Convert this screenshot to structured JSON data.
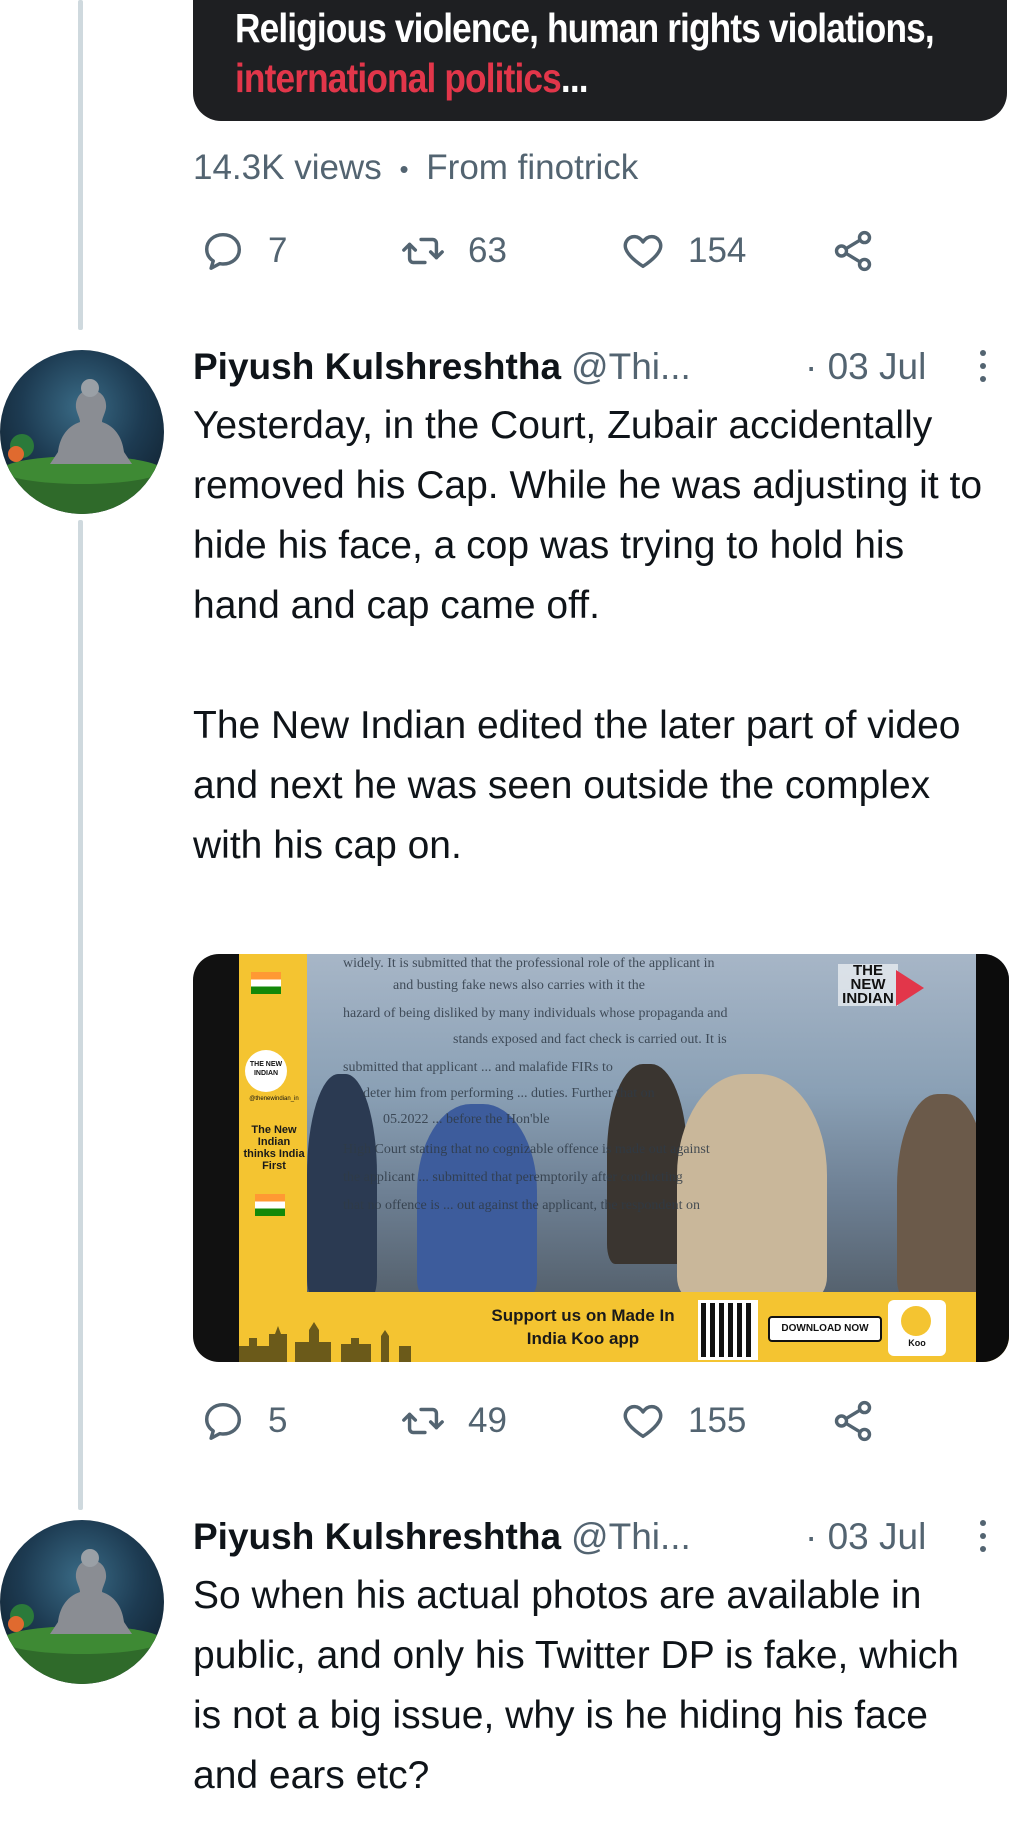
{
  "top_card": {
    "line1": "Religious violence, human rights violations,",
    "line2": "international politics",
    "ellipsis": "..."
  },
  "top_tweet": {
    "views": "14.3K views",
    "separator": "•",
    "source": "From finotrick",
    "actions": {
      "replies": "7",
      "retweets": "63",
      "likes": "154"
    }
  },
  "tweets": [
    {
      "name": "Piyush Kulshreshtha",
      "handle": "@Thi...",
      "date": "· 03 Jul",
      "paragraphs": [
        "Yesterday, in the Court, Zubair accidentally removed his Cap. While he was adjusting it to hide his face, a cop was trying to hold his hand and cap came off.",
        "The New Indian edited the later part of video and next he was seen outside the complex with his cap on."
      ],
      "actions": {
        "replies": "5",
        "retweets": "49",
        "likes": "155"
      },
      "video": {
        "logo_top": "THE NEW INDIAN",
        "tagline": "The New Indian thinks India First",
        "small_logo": "THE NEW INDIAN",
        "small_handle": "@thenewindian_in",
        "support": "Support us on Made In India Koo app",
        "download": "DOWNLOAD NOW",
        "koo": "Koo",
        "doc_lines": [
          "widely. It is submitted that the professional role of the applicant in",
          "and busting fake news also carries with it the",
          "hazard of being disliked by many individuals whose propaganda and",
          "stands exposed and fact check is carried out. It is",
          "submitted that applicant ... and malafide FIRs to",
          "deter him from performing ... duties. Further that on",
          "05.2022 ... before the Hon'ble",
          "High Court stating that no cognizable offence is made out against",
          "the applicant ... submitted that peremptorily after conducting",
          "that no offence is ... out against the applicant, the respondent on"
        ]
      }
    },
    {
      "name": "Piyush Kulshreshtha",
      "handle": "@Thi...",
      "date": "· 03 Jul",
      "paragraphs": [
        "So when his actual photos are available in public, and only his Twitter DP is fake, which is not a big issue, why is he hiding his face and ears etc?"
      ]
    }
  ],
  "colors": {
    "secondary_text": "#536471",
    "thread_line": "#cfd9de",
    "card_bg": "#1e1f22",
    "accent_red": "#e2364a",
    "koo_yellow": "#f4c431"
  }
}
